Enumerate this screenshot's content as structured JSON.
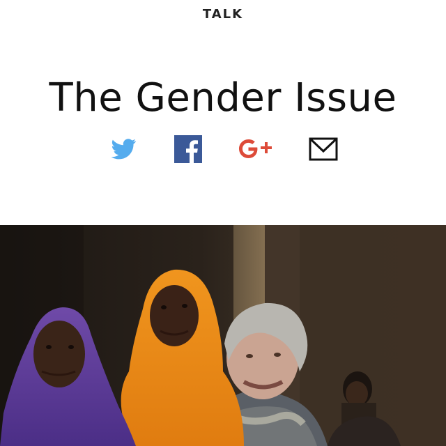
{
  "header": {
    "category": "TALK",
    "title": "The Gender Issue"
  },
  "share": {
    "icons": [
      "twitter-icon",
      "facebook-icon",
      "google-plus-icon",
      "email-icon"
    ],
    "colors": {
      "twitter": "#55acee",
      "facebook": "#3b5998",
      "google": "#dd4b39",
      "email": "#111111"
    }
  },
  "photo": {
    "subject": "Photograph of three women smiling in a dim room; left in purple hijab, center in orange hijab, right with gray hair and patterned scarf; a child in the background."
  }
}
